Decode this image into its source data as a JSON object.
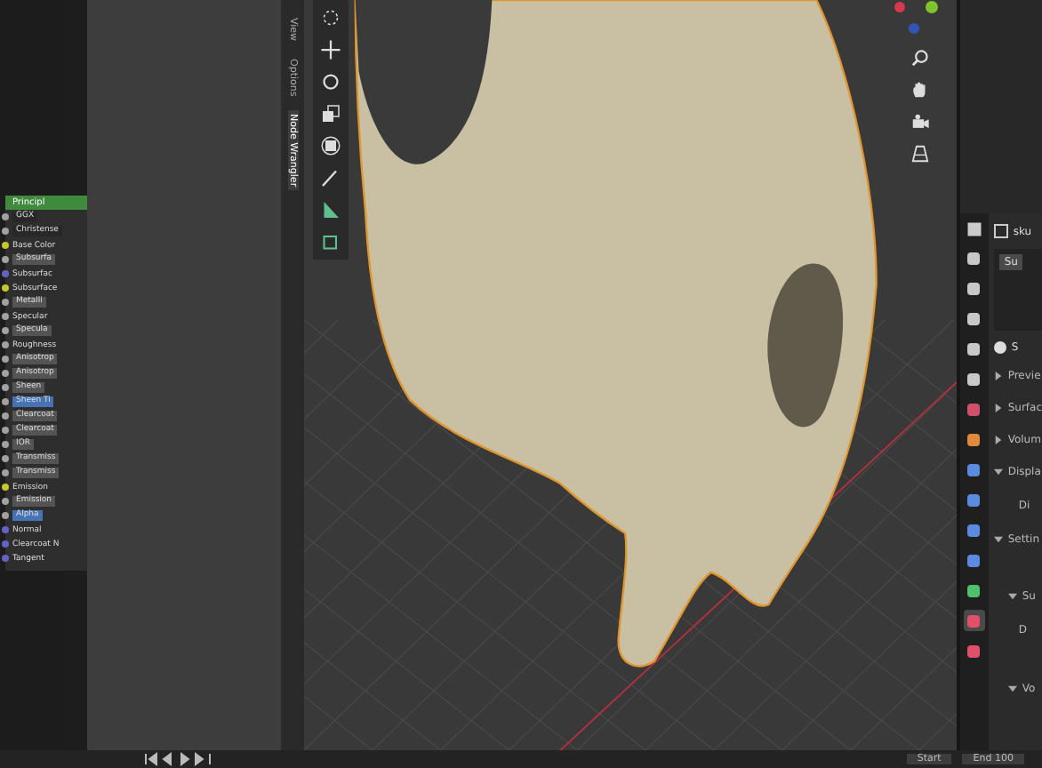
{
  "node_editor": {
    "node_title": "Principl",
    "rows": [
      {
        "label": "GGX",
        "kind": "enum",
        "color": "#a1a1a1"
      },
      {
        "label": "Christense",
        "kind": "enum",
        "color": "#a1a1a1"
      },
      {
        "label": "Base Color",
        "kind": "socket",
        "color": "#c7c729"
      },
      {
        "label": "Subsurfa",
        "kind": "input",
        "color": "#a1a1a1",
        "highlighted": false
      },
      {
        "label": "Subsurfac",
        "kind": "socket",
        "color": "#6363c7"
      },
      {
        "label": "Subsurface",
        "kind": "socket",
        "color": "#c7c729"
      },
      {
        "label": "Metalli",
        "kind": "input",
        "color": "#a1a1a1",
        "highlighted": false
      },
      {
        "label": "Specular",
        "kind": "socket",
        "color": "#a1a1a1"
      },
      {
        "label": "Specula",
        "kind": "input",
        "color": "#a1a1a1",
        "highlighted": false
      },
      {
        "label": "Roughness",
        "kind": "socket",
        "color": "#a1a1a1"
      },
      {
        "label": "Anisotrop",
        "kind": "input",
        "color": "#a1a1a1",
        "highlighted": false
      },
      {
        "label": "Anisotrop",
        "kind": "input",
        "color": "#a1a1a1",
        "highlighted": false
      },
      {
        "label": "Sheen",
        "kind": "input",
        "color": "#a1a1a1",
        "highlighted": false
      },
      {
        "label": "Sheen Ti",
        "kind": "input",
        "color": "#a1a1a1",
        "highlighted": true
      },
      {
        "label": "Clearcoat",
        "kind": "input",
        "color": "#a1a1a1",
        "highlighted": false
      },
      {
        "label": "Clearcoat",
        "kind": "input",
        "color": "#a1a1a1",
        "highlighted": false
      },
      {
        "label": "IOR",
        "kind": "input",
        "color": "#a1a1a1",
        "highlighted": false
      },
      {
        "label": "Transmiss",
        "kind": "input",
        "color": "#a1a1a1",
        "highlighted": false
      },
      {
        "label": "Transmiss",
        "kind": "input",
        "color": "#a1a1a1",
        "highlighted": false
      },
      {
        "label": "Emission",
        "kind": "socket",
        "color": "#c7c729"
      },
      {
        "label": "Emission",
        "kind": "input",
        "color": "#a1a1a1",
        "highlighted": false
      },
      {
        "label": "Alpha",
        "kind": "input",
        "color": "#a1a1a1",
        "highlighted": true
      },
      {
        "label": "Normal",
        "kind": "socket",
        "color": "#6363c7"
      },
      {
        "label": "Clearcoat N",
        "kind": "socket",
        "color": "#6363c7"
      },
      {
        "label": "Tangent",
        "kind": "socket",
        "color": "#6363c7"
      }
    ]
  },
  "sidebar_tabs": [
    {
      "label": "View",
      "selected": false
    },
    {
      "label": "Options",
      "selected": false
    },
    {
      "label": "Node Wrangler",
      "selected": true
    }
  ],
  "properties": {
    "object_name": "sku",
    "material_slot": "Su",
    "material_name": "S",
    "tabs": [
      {
        "color": "#c8c8c8",
        "selected": false
      },
      {
        "color": "#c8c8c8",
        "selected": false
      },
      {
        "color": "#c8c8c8",
        "selected": false
      },
      {
        "color": "#c8c8c8",
        "selected": false
      },
      {
        "color": "#c8c8c8",
        "selected": false
      },
      {
        "color": "#d0506a",
        "selected": false
      },
      {
        "color": "#e08a3c",
        "selected": false
      },
      {
        "color": "#5b8be0",
        "selected": false
      },
      {
        "color": "#5b8be0",
        "selected": false
      },
      {
        "color": "#5b8be0",
        "selected": false
      },
      {
        "color": "#5b8be0",
        "selected": false
      },
      {
        "color": "#4fc06b",
        "selected": false
      },
      {
        "color": "#e0506a",
        "selected": true
      },
      {
        "color": "#e0506a",
        "selected": false
      }
    ],
    "panels": [
      {
        "label": "Previe",
        "expanded": false,
        "kind": "panel"
      },
      {
        "label": "Surfac",
        "expanded": false,
        "kind": "panel"
      },
      {
        "label": "Volum",
        "expanded": false,
        "kind": "panel"
      },
      {
        "label": "Displa",
        "expanded": true,
        "kind": "panel"
      },
      {
        "label": "Di",
        "kind": "field"
      },
      {
        "label": "Settin",
        "expanded": true,
        "kind": "panel"
      },
      {
        "label": "Su",
        "expanded": true,
        "kind": "subpanel"
      },
      {
        "label": "D",
        "kind": "field"
      },
      {
        "label": "Vo",
        "expanded": true,
        "kind": "subpanel"
      }
    ]
  },
  "timeline": {
    "start_label": "Start",
    "end_label": "End",
    "end_value": "100"
  }
}
